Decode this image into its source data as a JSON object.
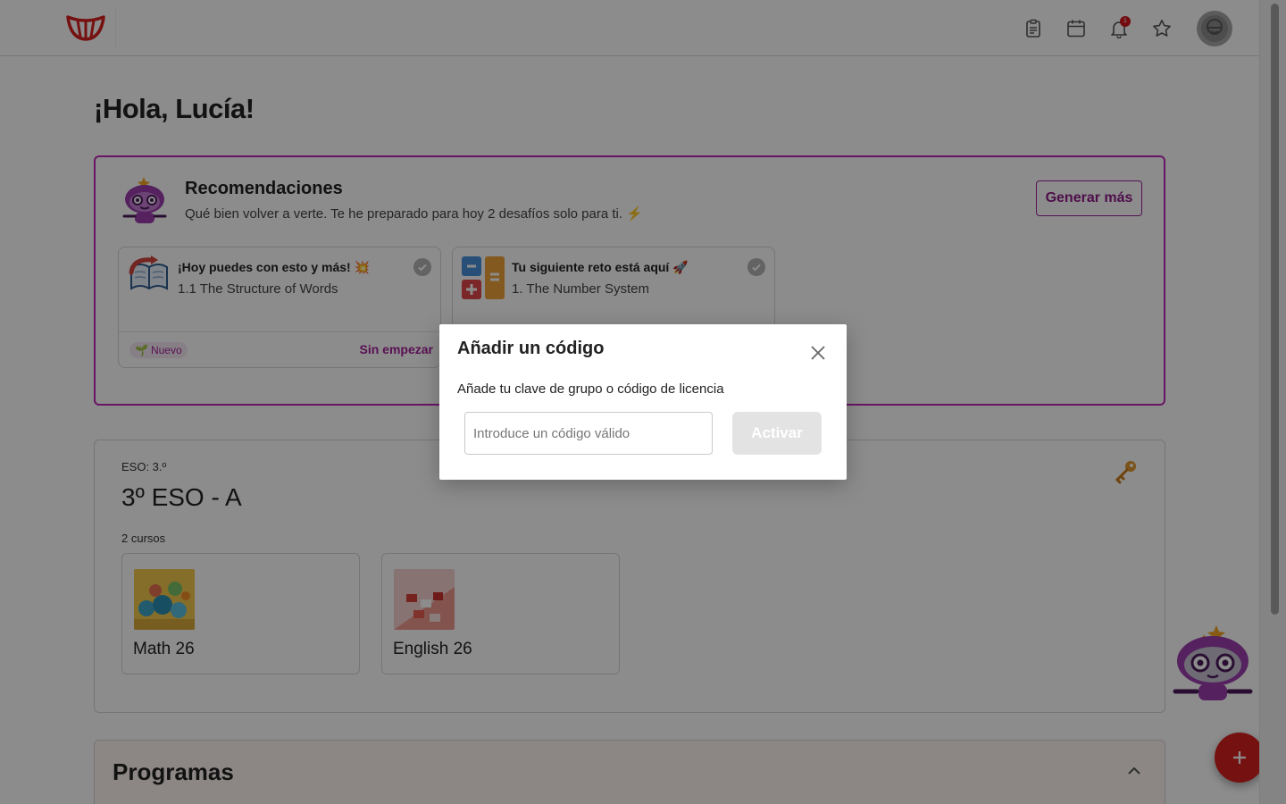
{
  "header": {
    "icons": [
      "clipboard-icon",
      "calendar-icon",
      "bell-icon",
      "star-icon",
      "user-avatar-icon"
    ],
    "notification_count": "1"
  },
  "greeting": "¡Hola, Lucía!",
  "recommendations": {
    "title": "Recomendaciones",
    "subtitle": "Qué bien volver a verte. Te he preparado para hoy 2 desafíos solo para ti. ⚡",
    "generate_button": "Generar más",
    "cards": [
      {
        "title": "¡Hoy puedes con esto y más! 💥",
        "subtitle": "1.1 The Structure of Words",
        "badge": "Nuevo",
        "status": "Sin empezar"
      },
      {
        "title": "Tu siguiente reto está aquí 🚀",
        "subtitle": "1. The Number System"
      }
    ]
  },
  "group": {
    "level": "ESO: 3.º",
    "name": "3º ESO - A",
    "course_count": "2 cursos",
    "courses": [
      {
        "name": "Math 26"
      },
      {
        "name": "English 26"
      }
    ]
  },
  "programs": {
    "title": "Programas"
  },
  "modal": {
    "title": "Añadir un código",
    "description": "Añade tu clave de grupo o código de licencia",
    "input_placeholder": "Introduce un código válido",
    "input_value": "",
    "activate_button": "Activar"
  },
  "colors": {
    "brand_magenta": "#c026b8",
    "brand_red": "#d7201f",
    "disabled_button": "#e3e3e3"
  }
}
